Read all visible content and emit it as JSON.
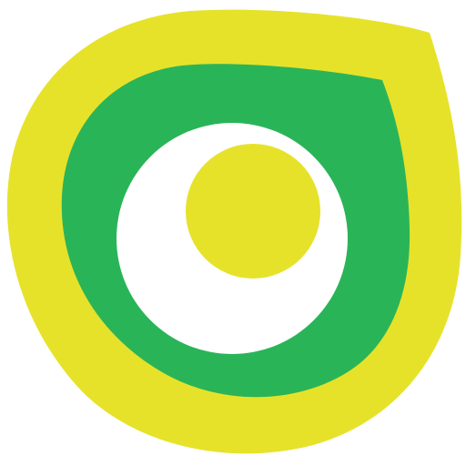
{
  "logo": {
    "icon": "teardrop-eye-logo-icon",
    "colors": {
      "outer": "#E6E22A",
      "middle": "#2AB458",
      "ring": "#FFFFFF",
      "center": "#E6E22A",
      "background": "#FFFFFF"
    }
  }
}
